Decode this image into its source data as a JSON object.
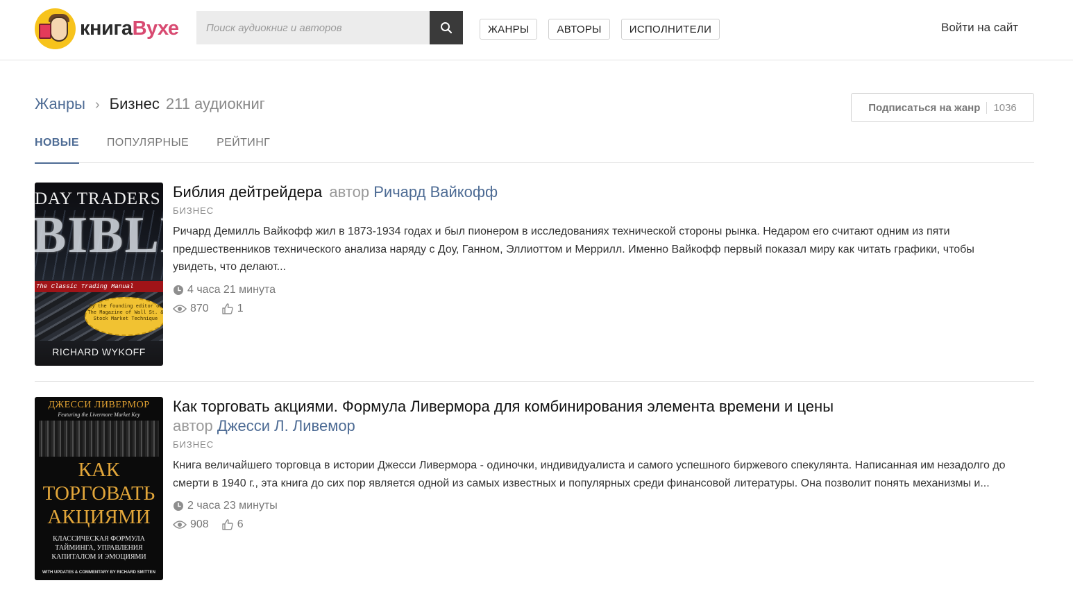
{
  "header": {
    "logo_text_main": "книга",
    "logo_text_accent": "Вухе",
    "search_placeholder": "Поиск аудиокниг и авторов",
    "nav": [
      {
        "label": "ЖАНРЫ"
      },
      {
        "label": "АВТОРЫ"
      },
      {
        "label": "ИСПОЛНИТЕЛИ"
      }
    ],
    "login": "Войти на сайт"
  },
  "genre_page": {
    "breadcrumb_root": "Жанры",
    "breadcrumb_separator": "›",
    "genre_name": "Бизнес",
    "book_count": "211 аудиокниг",
    "subscribe_label": "Подписаться на жанр",
    "subscribers": "1036",
    "tabs": [
      {
        "label": "НОВЫЕ",
        "active": true
      },
      {
        "label": "ПОПУЛЯРНЫЕ",
        "active": false
      },
      {
        "label": "РЕЙТИНГ",
        "active": false
      }
    ]
  },
  "books": [
    {
      "title": "Библия дейтрейдера",
      "author_prefix": "автор",
      "author": "Ричард Вайкофф",
      "genre": "БИЗНЕС",
      "description": "Ричард Демилль Вайкофф жил в 1873-1934 годах и был пионером в исследованиях технической стороны рынка. Недаром его считают одним из пяти предшественников технического анализа наряду с Доу, Ганном, Эллиоттом и Меррилл. Именно Вайкофф первый показал миру как читать графики, чтобы увидеть, что делают...",
      "duration": "4 часа 21 минута",
      "views": "870",
      "likes": "1",
      "cover": {
        "top_text": "DAY TRADERS",
        "big_text": "BIBLE",
        "band_text": "The Classic Trading Manual",
        "badge_text": "By the founding editor of The Magazine of Wall St. & Stock Market Technique",
        "author_text": "RICHARD WYKOFF"
      }
    },
    {
      "title": "Как торговать акциями. Формула Ливермора для комбинирования элемента времени и цены",
      "author_prefix": "автор",
      "author": "Джесси Л. Ливемор",
      "genre": "БИЗНЕС",
      "description": "Книга величайшего торговца в истории Джесси Ливермора - одиночки, индивидуалиста и самого успешного биржевого спекулянта. Написанная им незадолго до смерти в 1940 г., эта книга до сих пор является одной из самых известных и популярных среди финансовой литературы. Она позволит понять механизмы и...",
      "duration": "2 часа 23 минуты",
      "views": "908",
      "likes": "6",
      "cover": {
        "name_text": "ДЖЕССИ ЛИВЕРМОР",
        "sub_text": "Featuring the Livermore Market Key",
        "title_line1": "КАК",
        "title_line2": "ТОРГОВАТЬ",
        "title_line3": "АКЦИЯМИ",
        "desc_text": "КЛАССИЧЕСКАЯ ФОРМУЛА ТАЙМИНГА, УПРАВЛЕНИЯ КАПИТАЛОМ И ЭМОЦИЯМИ",
        "foot_text": "WITH UPDATES & COMMENTARY BY RICHARD SMITTEN"
      }
    }
  ],
  "icons": {
    "search": "search-icon",
    "clock": "clock-icon",
    "eye": "eye-icon",
    "thumb": "thumbs-up-icon"
  },
  "colors": {
    "link": "#4d6b94",
    "logo_yellow": "#f7c31c",
    "logo_accent": "#d84a71",
    "search_button": "#3a3a3a"
  }
}
